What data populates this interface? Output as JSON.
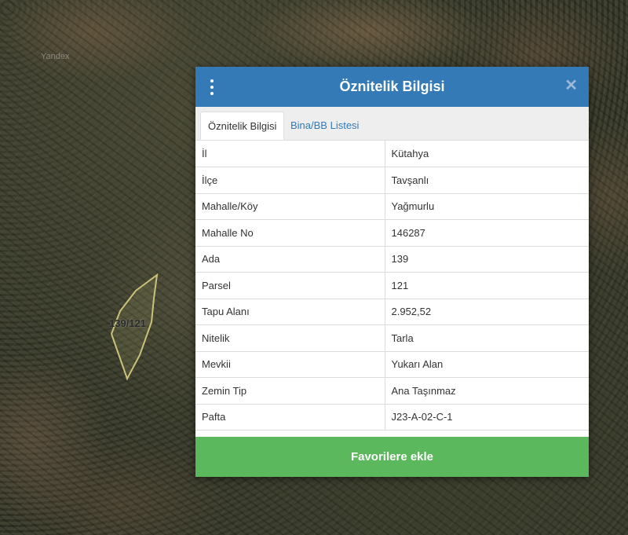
{
  "map": {
    "brand": "Yandex",
    "parcel_label": "139/121"
  },
  "dialog": {
    "title": "Öznitelik Bilgisi",
    "menu_icon": "kebab-menu-icon",
    "close_icon": "close-icon",
    "tabs": [
      {
        "label": "Öznitelik Bilgisi",
        "active": true
      },
      {
        "label": "Bina/BB Listesi",
        "active": false
      }
    ],
    "rows": [
      {
        "key": "İl",
        "value": "Kütahya"
      },
      {
        "key": "İlçe",
        "value": "Tavşanlı"
      },
      {
        "key": "Mahalle/Köy",
        "value": "Yağmurlu"
      },
      {
        "key": "Mahalle No",
        "value": "146287"
      },
      {
        "key": "Ada",
        "value": "139"
      },
      {
        "key": "Parsel",
        "value": "121"
      },
      {
        "key": "Tapu Alanı",
        "value": "2.952,52"
      },
      {
        "key": "Nitelik",
        "value": "Tarla"
      },
      {
        "key": "Mevkii",
        "value": "Yukarı Alan"
      },
      {
        "key": "Zemin Tip",
        "value": "Ana Taşınmaz"
      },
      {
        "key": "Pafta",
        "value": "J23-A-02-C-1"
      }
    ],
    "favorite_button": "Favorilere ekle"
  },
  "colors": {
    "header": "#337ab7",
    "button": "#5cb85c",
    "tab_link": "#337ab7",
    "parcel_outline": "#c9c27a"
  }
}
